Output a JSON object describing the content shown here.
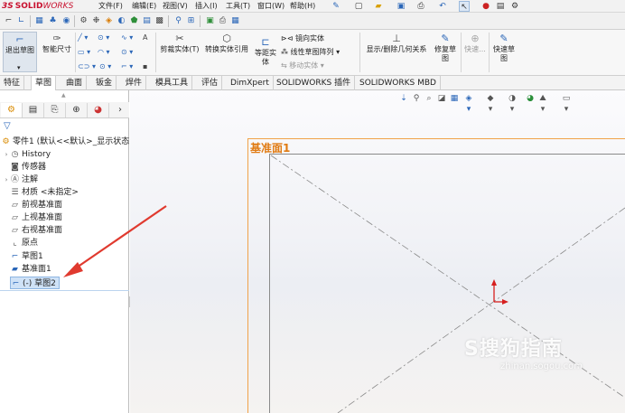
{
  "app": {
    "logo_ds": "3S",
    "logo_solid": "SOLID",
    "logo_works": "WORKS"
  },
  "menu": [
    "文件(F)",
    "编辑(E)",
    "视图(V)",
    "插入(I)",
    "工具(T)",
    "窗口(W)",
    "帮助(H)"
  ],
  "ribbon": {
    "exit_sketch": "退出草图",
    "smart_dimension": "智能尺寸",
    "trim_entities": "剪裁实体(T)",
    "convert_entities": "转换实体引用",
    "offset_entities": "等距实体",
    "mirror_entities": "镜向实体",
    "linear_pattern": "线性草图阵列",
    "move_entities": "移动实体",
    "display_delete_relations": "显示/删除几何关系",
    "repair_sketch": "修复草图",
    "quick_snaps": "快速...",
    "rapid_sketch": "快速草图"
  },
  "tabs": [
    "特征",
    "草图",
    "曲面",
    "钣金",
    "焊件",
    "模具工具",
    "评估",
    "DimXpert",
    "SOLIDWORKS 插件",
    "SOLIDWORKS MBD"
  ],
  "active_tab_index": 1,
  "tree": {
    "root": "零件1 (默认<<默认>_显示状态",
    "items": [
      {
        "label": "History",
        "icon": "history-icon"
      },
      {
        "label": "传感器",
        "icon": "sensor-icon"
      },
      {
        "label": "注解",
        "icon": "annotation-icon"
      },
      {
        "label": "材质 <未指定>",
        "icon": "material-icon"
      },
      {
        "label": "前视基准面",
        "icon": "plane-icon"
      },
      {
        "label": "上视基准面",
        "icon": "plane-icon"
      },
      {
        "label": "右视基准面",
        "icon": "plane-icon"
      },
      {
        "label": "原点",
        "icon": "origin-icon"
      },
      {
        "label": "草图1",
        "icon": "sketch-icon"
      },
      {
        "label": "基准面1",
        "icon": "plane-icon"
      },
      {
        "label": "(-) 草图2",
        "icon": "sketch-icon"
      }
    ],
    "selected": "(-) 草图2"
  },
  "viewport": {
    "plane_label": "基准面1"
  },
  "watermark": {
    "main": "S搜狗指南",
    "sub": "zhinan.sogou.com"
  },
  "colors": {
    "brand": "#c8102e",
    "plane_border": "#f0a24a",
    "selection": "#cfe2f7",
    "arrow": "#e03a2f"
  }
}
